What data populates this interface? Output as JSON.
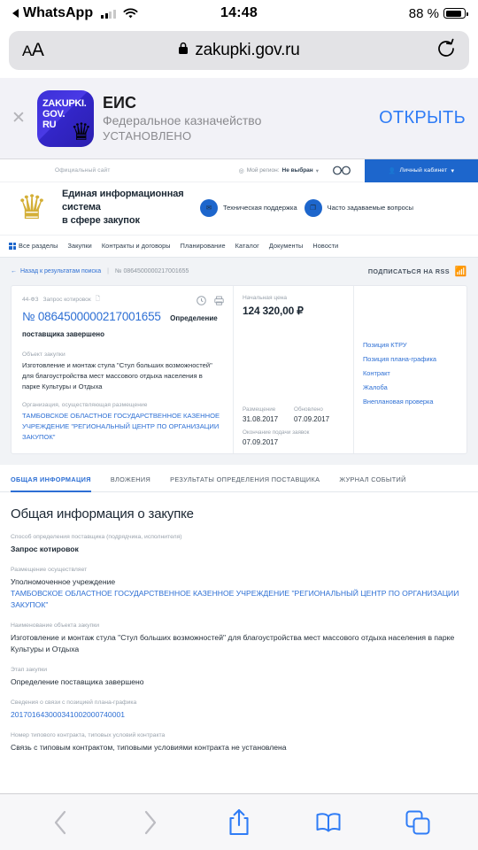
{
  "status_bar": {
    "back_app": "WhatsApp",
    "time": "14:48",
    "battery_text": "88 %",
    "battery_level": 88,
    "signal_bars": 2,
    "wifi_icon": "wifi-icon"
  },
  "browser": {
    "text_size_label": "AA",
    "url": "zakupki.gov.ru",
    "lock_icon": "lock-icon",
    "reload_icon": "reload-icon"
  },
  "app_banner": {
    "close_icon": "close-icon",
    "icon_line1": "ZAKUPKI.",
    "icon_line2": "GOV.",
    "icon_line3": "RU",
    "title": "ЕИС",
    "subtitle": "Федеральное казначейство",
    "status": "УСТАНОВЛЕНО",
    "action": "ОТКРЫТЬ",
    "accent": "#2f7cf6"
  },
  "site_header": {
    "official_label": "Официальный сайт",
    "region_label": "Мой регион:",
    "region_value": "Не выбран",
    "glasses_icon": "accessibility-glasses-icon",
    "cabinet_label": "Личный кабинет",
    "system_name_line1": "Единая информационная система",
    "system_name_line2": "в сфере закупок",
    "emblem_icon": "russian-coat-of-arms-icon",
    "support_label": "Техническая поддержка",
    "support_icon": "mail-icon",
    "faq_label": "Часто задаваемые вопросы",
    "faq_icon": "copy-icon",
    "brand_blue": "#1d66cc"
  },
  "nav": {
    "items": [
      "Все разделы",
      "Закупки",
      "Контракты и договоры",
      "Планирование",
      "Каталог",
      "Документы",
      "Новости"
    ]
  },
  "breadcrumb": {
    "back_icon": "arrow-left-icon",
    "back_label": "Назад к результатам поиска",
    "separator": "|",
    "number": "№ 0864500000217001655",
    "rss_label": "ПОДПИСАТЬСЯ НА RSS",
    "rss_icon": "rss-icon"
  },
  "card": {
    "law_label": "44-ФЗ",
    "method_label": "Запрос котировок",
    "doc_icon": "document-icon",
    "watch_icon": "clock-icon",
    "print_icon": "printer-icon",
    "registry_number": "№ 0864500000217001655",
    "stage": "Определение поставщика завершено",
    "object_label": "Объект закупки",
    "object_value": "Изготовление и монтаж стула \"Стул больших возможностей\" для благоустройства мест массового отдыха населения в парке Культуры и Отдыха",
    "org_label": "Организация, осуществляющая размещение",
    "org_value": "ТАМБОВСКОЕ ОБЛАСТНОЕ ГОСУДАРСТВЕННОЕ КАЗЕННОЕ УЧРЕЖДЕНИЕ \"РЕГИОНАЛЬНЫЙ ЦЕНТР ПО ОРГАНИЗАЦИИ ЗАКУПОК\"",
    "price_label": "Начальная цена",
    "price_value": "124 320,00 ₽",
    "placed_label": "Размещение",
    "placed_value": "31.08.2017",
    "updated_label": "Обновлено",
    "updated_value": "07.09.2017",
    "deadline_label": "Окончание подачи заявок",
    "deadline_value": "07.09.2017",
    "links": [
      "Позиция КТРУ",
      "Позиция плана-графика",
      "Контракт",
      "Жалоба",
      "Внеплановая проверка"
    ]
  },
  "tabs": [
    {
      "label": "ОБЩАЯ ИНФОРМАЦИЯ",
      "active": true
    },
    {
      "label": "ВЛОЖЕНИЯ",
      "active": false
    },
    {
      "label": "РЕЗУЛЬТАТЫ ОПРЕДЕЛЕНИЯ ПОСТАВЩИКА",
      "active": false
    },
    {
      "label": "ЖУРНАЛ СОБЫТИЙ",
      "active": false
    }
  ],
  "info": {
    "heading": "Общая информация о закупке",
    "fields": [
      {
        "label": "Способ определения поставщика (подрядчика, исполнителя)",
        "value": "Запрос котировок",
        "link": false,
        "bold": true
      },
      {
        "label": "Размещение осуществляет",
        "value": "Уполномоченное учреждение",
        "value2": "ТАМБОВСКОЕ ОБЛАСТНОЕ ГОСУДАРСТВЕННОЕ КАЗЕННОЕ УЧРЕЖДЕНИЕ \"РЕГИОНАЛЬНЫЙ ЦЕНТР ПО ОРГАНИЗАЦИИ ЗАКУПОК\"",
        "link": false
      },
      {
        "label": "Наименование объекта закупки",
        "value": "Изготовление и монтаж стула \"Стул больших возможностей\" для благоустройства мест массового отдыха населения в парке Культуры и Отдыха",
        "link": false
      },
      {
        "label": "Этап закупки",
        "value": "Определение поставщика завершено",
        "link": false
      },
      {
        "label": "Сведения о связи с позицией плана-графика",
        "value": "201701643000341002000074 0001",
        "link": true
      },
      {
        "label": "Номер типового контракта, типовых условий контракта",
        "value": "Связь с типовым контрактом, типовыми условиями контракта не установлена",
        "link": false
      }
    ],
    "plan_graph_number": "201701643000341002000740001"
  },
  "toolbar": {
    "back_icon": "chevron-left-icon",
    "forward_icon": "chevron-right-icon",
    "share_icon": "share-icon",
    "bookmarks_icon": "book-icon",
    "tabs_icon": "tabs-icon",
    "accent": "#2f7cf6"
  }
}
